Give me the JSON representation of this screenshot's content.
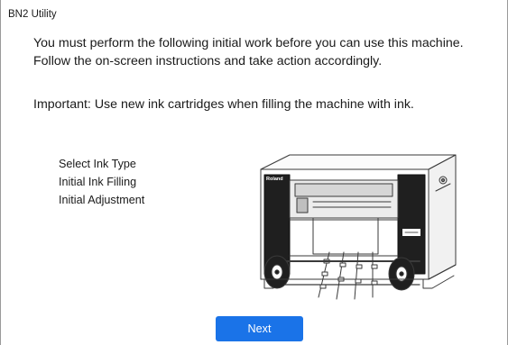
{
  "window": {
    "title": "BN2 Utility"
  },
  "intro": {
    "line1": "You must perform the following initial work before you can use this machine.",
    "line2": "Follow the on-screen instructions and take action accordingly."
  },
  "important": {
    "text": "Important: Use new ink cartridges when filling the machine with ink."
  },
  "steps": [
    {
      "label": "Select Ink Type"
    },
    {
      "label": "Initial Ink Filling"
    },
    {
      "label": "Initial Adjustment"
    }
  ],
  "illustration": {
    "icon": "printer-illustration",
    "brand_text": "Roland"
  },
  "buttons": {
    "next_label": "Next"
  },
  "colors": {
    "accent": "#1a73e8"
  }
}
